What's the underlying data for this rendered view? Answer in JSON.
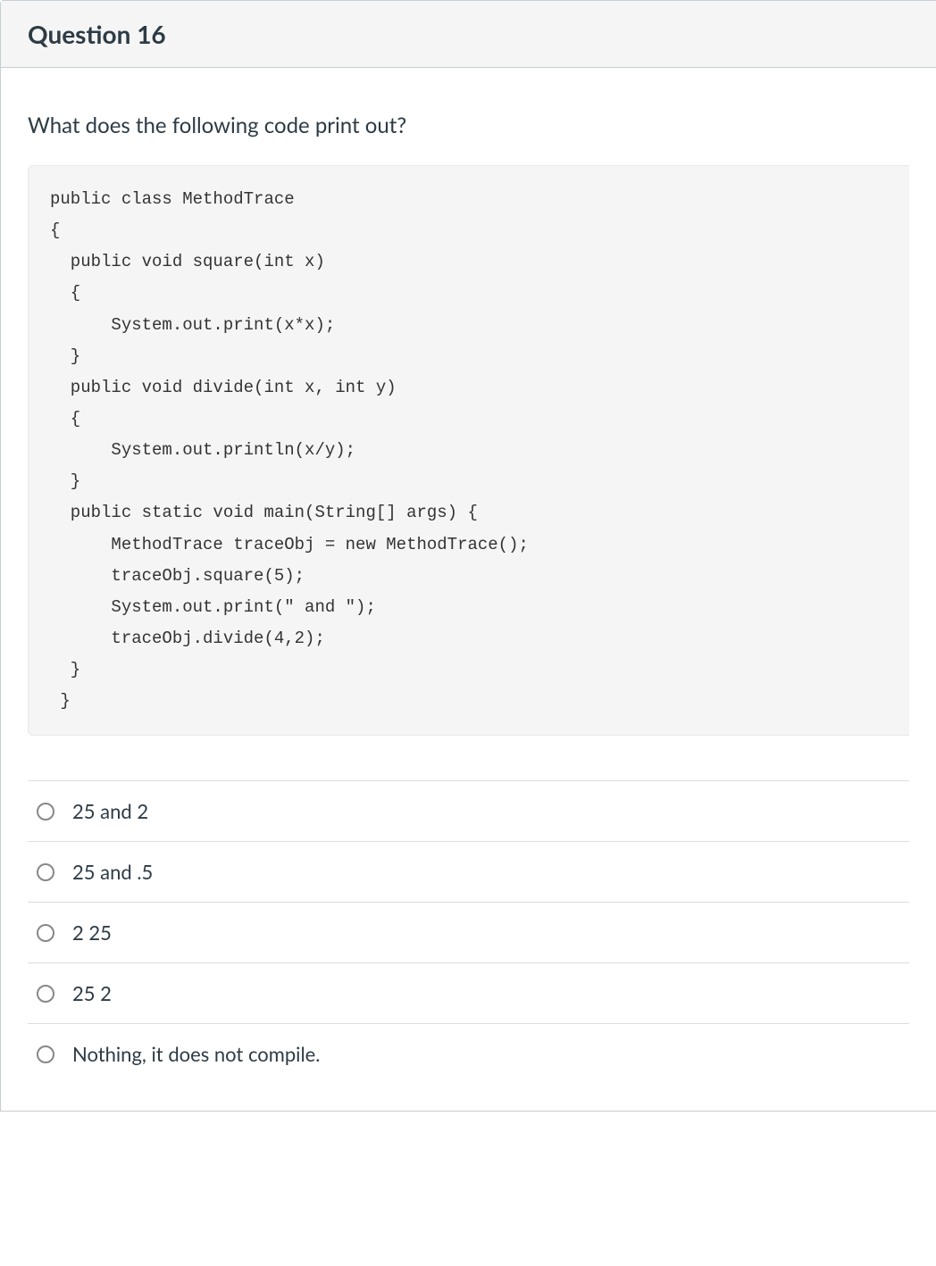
{
  "question": {
    "title": "Question 16",
    "prompt": "What does the following code print out?",
    "code": "public class MethodTrace\n{\n  public void square(int x)\n  {\n      System.out.print(x*x);\n  }\n  public void divide(int x, int y)\n  {\n      System.out.println(x/y);\n  }\n  public static void main(String[] args) {\n      MethodTrace traceObj = new MethodTrace();\n      traceObj.square(5);\n      System.out.print(\" and \");\n      traceObj.divide(4,2);\n  }\n }"
  },
  "answers": [
    {
      "label": "25 and 2"
    },
    {
      "label": "25 and .5"
    },
    {
      "label": "2 25"
    },
    {
      "label": "25 2"
    },
    {
      "label": "Nothing, it does not compile."
    }
  ]
}
